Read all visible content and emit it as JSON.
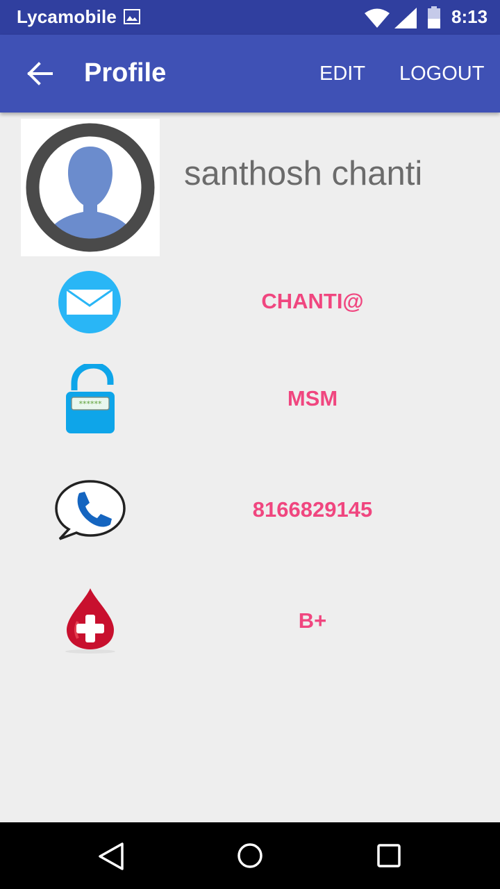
{
  "status_bar": {
    "carrier": "Lycamobile",
    "time": "8:13"
  },
  "app_bar": {
    "title": "Profile",
    "edit_label": "EDIT",
    "logout_label": "LOGOUT"
  },
  "profile": {
    "name": "santhosh chanti",
    "email": "CHANTI@",
    "password": "MSM",
    "phone": "8166829145",
    "blood_group": "B+"
  },
  "icons": {
    "email": "mail-icon",
    "password": "lock-icon",
    "phone": "phone-icon",
    "blood_group": "blood-drop-icon"
  },
  "colors": {
    "status_bar": "#303f9f",
    "app_bar": "#3f51b5",
    "value_text": "#f0467f",
    "name_text": "#6b6b6b",
    "background": "#eeeeee"
  }
}
